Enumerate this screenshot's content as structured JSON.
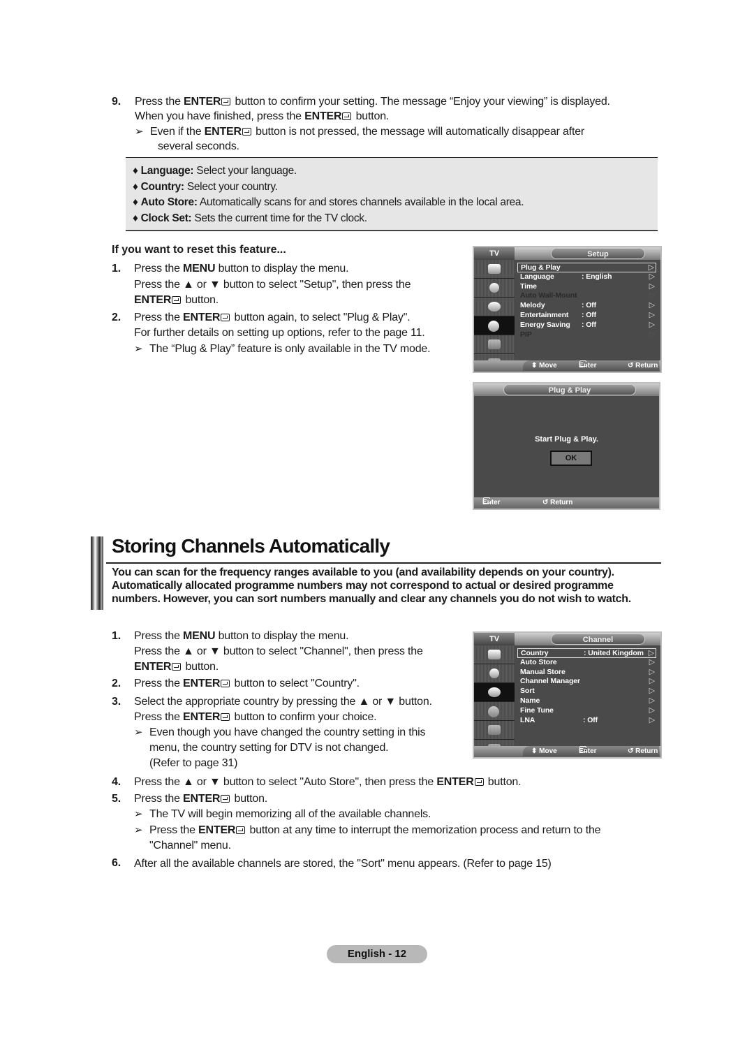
{
  "step9": {
    "num": "9.",
    "line1_a": "Press the ",
    "enter": "ENTER",
    "line1_b": " button to confirm your setting. The message “Enjoy your viewing” is displayed.",
    "line2_a": "When you have finished, press the ",
    "line2_b": " button.",
    "note_a": "Even if the ",
    "note_b": " button is not pressed, the message will automatically disappear after",
    "note_c": "several seconds."
  },
  "notes": [
    {
      "label": "Language:",
      "text": " Select your language."
    },
    {
      "label": "Country:",
      "text": " Select your country."
    },
    {
      "label": "Auto Store:",
      "text": " Automatically scans for and stores channels available in the local area."
    },
    {
      "label": "Clock Set:",
      "text": " Sets the current time for the TV clock."
    }
  ],
  "reset": {
    "heading": "If you want to reset this feature...",
    "s1_num": "1.",
    "s1_a": "Press the ",
    "s1_menu": "MENU",
    "s1_b": " button to display the menu.",
    "s1_c": "Press the ▲ or ▼ button to select \"Setup\", then press the",
    "s1_enter": "ENTER",
    "s1_d": " button.",
    "s2_num": "2.",
    "s2_a": "Press the ",
    "s2_enter": "ENTER",
    "s2_b": " button again, to select \"Plug & Play\".",
    "s2_c": "For further details on setting up options, refer to the page 11.",
    "s2_note": "The “Plug & Play” feature is only available in the TV mode."
  },
  "setup_osd": {
    "tv": "TV",
    "title": "Setup",
    "rows": [
      {
        "label": "Plug & Play",
        "value": "",
        "selected": true,
        "dim": false
      },
      {
        "label": "Language",
        "value": ": English",
        "selected": false,
        "dim": false
      },
      {
        "label": "Time",
        "value": "",
        "selected": false,
        "dim": false
      },
      {
        "label": "Auto Wall-Mount",
        "value": "",
        "selected": false,
        "dim": true
      },
      {
        "label": "Melody",
        "value": ": Off",
        "selected": false,
        "dim": false
      },
      {
        "label": "Entertainment",
        "value": ": Off",
        "selected": false,
        "dim": false
      },
      {
        "label": "Energy Saving",
        "value": ": Off",
        "selected": false,
        "dim": false
      },
      {
        "label": "PIP",
        "value": "",
        "selected": false,
        "dim": true
      }
    ],
    "footer": {
      "move": "⬍ Move",
      "enter": "Enter",
      "return": "↺ Return"
    }
  },
  "plug_osd": {
    "title": "Plug & Play",
    "message": "Start Plug & Play.",
    "ok": "OK",
    "footer": {
      "enter": "Enter",
      "return": "↺ Return"
    }
  },
  "section": {
    "title": "Storing Channels Automatically",
    "intro": "You can scan for the frequency ranges available to you (and availability depends on your country). Automatically allocated programme numbers may not correspond to actual or desired programme numbers. However, you can sort numbers manually and clear any channels you do not wish to watch."
  },
  "steps": {
    "s1_num": "1.",
    "s1_a": "Press the ",
    "s1_menu": "MENU",
    "s1_b": " button to display the menu.",
    "s1_c": "Press the ▲ or ▼ button to select \"Channel\", then press the",
    "s1_enter": "ENTER",
    "s1_d": " button.",
    "s2_num": "2.",
    "s2_a": "Press the ",
    "s2_enter": "ENTER",
    "s2_b": " button to select \"Country\".",
    "s3_num": "3.",
    "s3_a": "Select the appropriate country by pressing the ▲ or ▼ button.",
    "s3_b": "Press the ",
    "s3_enter": "ENTER",
    "s3_c": " button to confirm your choice.",
    "s3_note1": "Even though you have changed the country setting in this",
    "s3_note2": "menu, the country setting for DTV is not changed.",
    "s3_note3": "(Refer to page 31)",
    "s4_num": "4.",
    "s4_a": "Press the ▲ or ▼ button to select \"Auto Store\", then press the ",
    "s4_enter": "ENTER",
    "s4_b": " button.",
    "s5_num": "5.",
    "s5_a": "Press the ",
    "s5_enter": "ENTER",
    "s5_b": " button.",
    "s5_note1": "The TV will begin memorizing all of the available channels.",
    "s5_note2_a": "Press the ",
    "s5_note2_enter": "ENTER",
    "s5_note2_b": " button at any time to interrupt the memorization process and return to the",
    "s5_note2_c": "\"Channel\" menu.",
    "s6_num": "6.",
    "s6_a": "After all the available channels are stored, the \"Sort\" menu appears. (Refer to page 15)"
  },
  "channel_osd": {
    "tv": "TV",
    "title": "Channel",
    "rows": [
      {
        "label": "Country",
        "value": ": United Kingdom",
        "selected": true,
        "dim": false
      },
      {
        "label": "Auto Store",
        "value": "",
        "selected": false,
        "dim": false
      },
      {
        "label": "Manual Store",
        "value": "",
        "selected": false,
        "dim": false
      },
      {
        "label": "Channel Manager",
        "value": "",
        "selected": false,
        "dim": false
      },
      {
        "label": "Sort",
        "value": "",
        "selected": false,
        "dim": false
      },
      {
        "label": "Name",
        "value": "",
        "selected": false,
        "dim": false
      },
      {
        "label": "Fine Tune",
        "value": "",
        "selected": false,
        "dim": false
      },
      {
        "label": "LNA",
        "value": ": Off",
        "selected": false,
        "dim": false
      }
    ],
    "footer": {
      "move": "⬍ Move",
      "enter": "Enter",
      "return": "↺ Return"
    }
  },
  "page": {
    "label": "English - 12"
  },
  "icons": {
    "note_arrow": "➢",
    "triangle_right": "▷"
  }
}
